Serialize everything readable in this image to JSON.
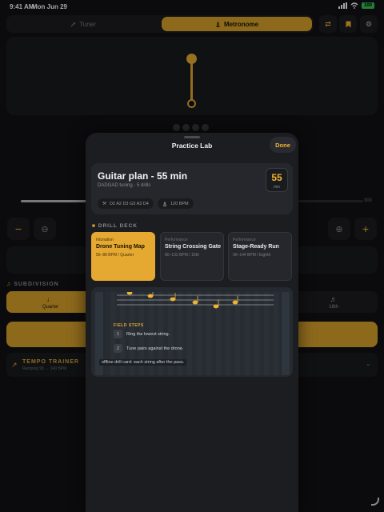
{
  "status_bar": {
    "time": "9:41 AM",
    "date": "Mon Jun 29",
    "battery": "100"
  },
  "background": {
    "tabs": [
      {
        "label": "Tuner",
        "icon": "tuning-fork-icon",
        "selected": false
      },
      {
        "label": "Metronome",
        "icon": "metronome-icon",
        "selected": true
      }
    ],
    "toolbar_icons": [
      "routing-icon",
      "bookmark-icon",
      "gear-icon"
    ],
    "slider": {
      "min_label": "",
      "max_label": "300",
      "value_fraction": 0.2
    },
    "subdivision": {
      "title": "SUBDIVISION",
      "options": [
        {
          "label": "Quarter",
          "icon": "quarter-note-icon",
          "selected": true
        },
        {
          "label": "16th",
          "icon": "sixteenth-note-icon",
          "selected": false
        }
      ]
    },
    "tempo_trainer": {
      "title": "TEMPO TRAINER",
      "subtitle": "Ramping 95 → 140 BPM"
    }
  },
  "sheet": {
    "title": "Practice Lab",
    "done_label": "Done",
    "plan": {
      "title": "Guitar plan - 55 min",
      "subtitle": "DADGAD tuning - 5 drills",
      "minutes": "55",
      "minutes_unit": "min",
      "tuning_chip": "D2 A2 D3 G3 A3 D4",
      "tempo_chip": "120 BPM"
    },
    "deck": {
      "title": "DRILL DECK",
      "drills": [
        {
          "category": "Intonation",
          "name": "Drone Tuning Map",
          "meta": "56–88 BPM / Quarter",
          "selected": true
        },
        {
          "category": "Performance",
          "name": "String Crossing Gate",
          "meta": "80–132 BPM / 16th",
          "selected": false
        },
        {
          "category": "Performance",
          "name": "Stage-Ready Run",
          "meta": "90–144 BPM / Eighth",
          "selected": false
        }
      ]
    },
    "field_steps": {
      "title": "FIELD STEPS",
      "steps": [
        {
          "num": "1",
          "text": "Ring the lowest string."
        },
        {
          "num": "2",
          "text": "Tune pairs against the drone."
        }
      ],
      "overlay_text": "offline drill card: each string after the pass."
    }
  },
  "colors": {
    "accent": "#e2a630",
    "background": "#111214",
    "sheet": "#1c1d21",
    "card": "#26272c"
  }
}
